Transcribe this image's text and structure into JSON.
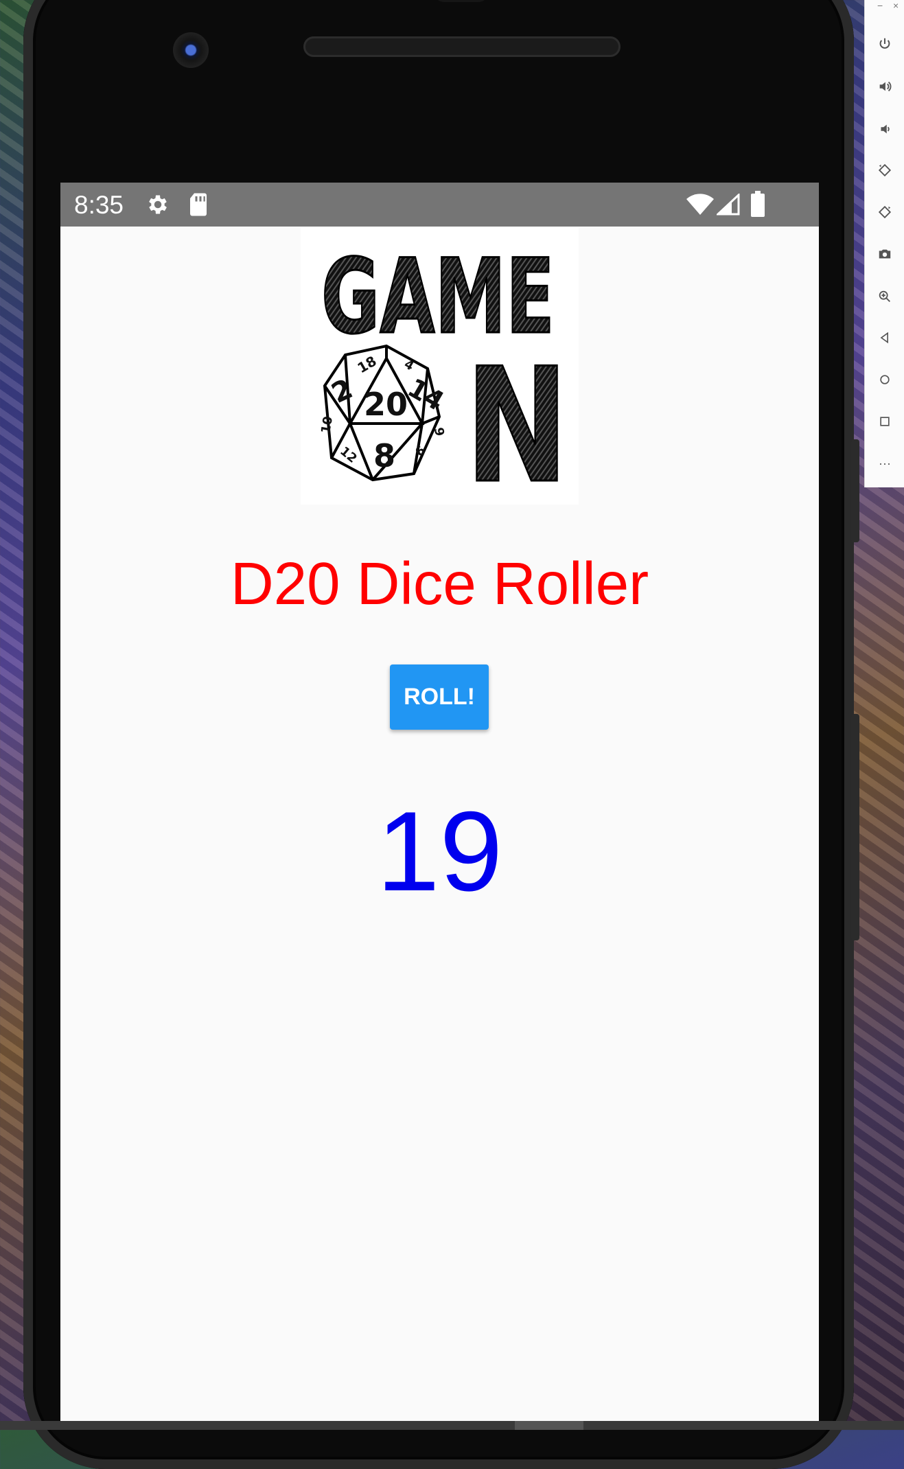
{
  "status_bar": {
    "time": "8:35",
    "left_icons": [
      "settings-icon",
      "sd-card-icon"
    ],
    "right_icons": [
      "wifi-icon",
      "cell-signal-icon",
      "battery-icon"
    ]
  },
  "app": {
    "logo": {
      "text_top": "GAME",
      "text_side": "N",
      "die_center": "20",
      "die_numbers": [
        "2",
        "14",
        "8",
        "18",
        "12",
        "10",
        "6",
        "4",
        "9"
      ]
    },
    "title": "D20 Dice Roller",
    "roll_button_label": "ROLL!",
    "result": "19",
    "colors": {
      "title": "#ff0000",
      "result": "#0000ee",
      "button": "#2196f3",
      "status_bar": "#757575"
    }
  },
  "emulator_toolbar": {
    "window_controls": [
      "−",
      "×"
    ],
    "buttons": [
      "power-icon",
      "volume-up-icon",
      "volume-down-icon",
      "rotate-left-icon",
      "rotate-right-icon",
      "camera-icon",
      "zoom-icon",
      "back-icon",
      "home-icon",
      "overview-icon",
      "more-icon"
    ],
    "more_label": "···"
  }
}
